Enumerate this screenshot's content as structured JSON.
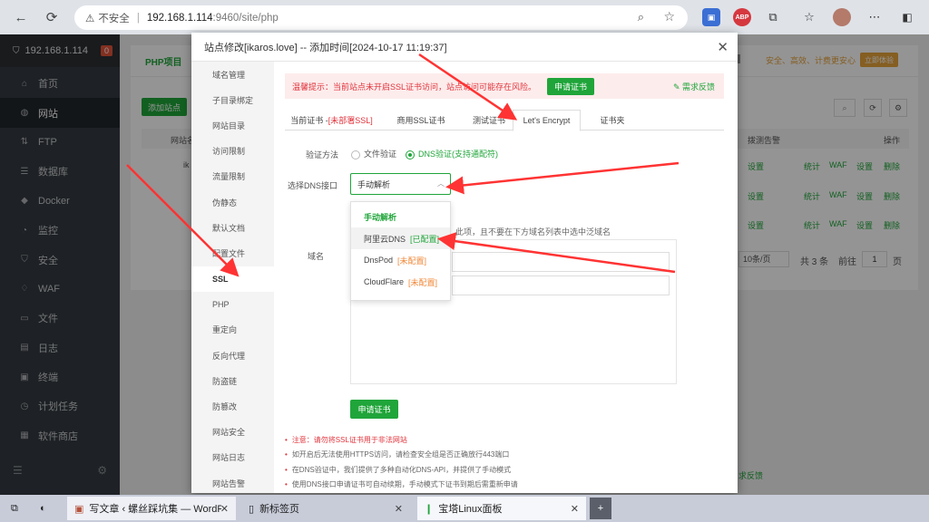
{
  "browser": {
    "not_secure": "不安全",
    "url_host": "192.168.1.114",
    "url_path": ":9460/site/php",
    "ext_abp": "ABP"
  },
  "sidebar": {
    "server": "192.168.1.114",
    "badge": "0",
    "items": [
      "首页",
      "网站",
      "FTP",
      "数据库",
      "Docker",
      "监控",
      "安全",
      "WAF",
      "文件",
      "日志",
      "终端",
      "计划任务",
      "软件商店"
    ]
  },
  "panel": {
    "tab": "PHP项目",
    "add_site": "添加站点",
    "col_site": "网站名",
    "col_alarm": "拨测告警",
    "col_ops": "操作",
    "row_ik": "ik",
    "setting": "设置",
    "stats": "统计",
    "waf": "WAF",
    "delete": "删除",
    "banner": "安全、高效、计费更安心",
    "try_btn": "立即体验",
    "page_size": "10条/页",
    "total": "共 3 条",
    "goto": "前往",
    "page_no": "1",
    "page_unit": "页",
    "footer_link": "求反馈"
  },
  "modal": {
    "title": "站点修改[ikaros.love] -- 添加时间[2024-10-17 11:19:37]",
    "menu": [
      "域名管理",
      "子目录绑定",
      "网站目录",
      "访问限制",
      "流量限制",
      "伪静态",
      "默认文档",
      "配置文件",
      "SSL",
      "PHP",
      "重定向",
      "反向代理",
      "防盗链",
      "防篡改",
      "网站安全",
      "网站日志",
      "网站告警"
    ],
    "tip": "温馨提示：当前站点未开启SSL证书访问，站点访问可能存在风险。",
    "tip_btn": "申请证书",
    "feedback": "需求反馈",
    "tabs": {
      "current_prefix": "当前证书 - ",
      "current_state": "[未部署SSL]",
      "commercial": "商用SSL证书",
      "test": "测试证书",
      "le": "Let's Encrypt",
      "folder": "证书夹"
    },
    "verify_label": "验证方法",
    "verify_file": "文件验证",
    "verify_dns": "DNS验证(支持通配符)",
    "dns_label": "选择DNS接口",
    "dns_value": "手动解析",
    "dropdown": [
      {
        "name": "手动解析",
        "status": ""
      },
      {
        "name": "阿里云DNS",
        "status": "[已配置]"
      },
      {
        "name": "DnsPod",
        "status": "[未配置]"
      },
      {
        "name": "CloudFlare",
        "status": "[未配置]"
      }
    ],
    "hint": "此项，且不要在下方域名列表中选中泛域名",
    "domain_label": "域名",
    "apply_btn": "申请证书",
    "notes": [
      "注意：请勿将SSL证书用于非法网站",
      "如开启后无法使用HTTPS访问，请检查安全组是否正确放行443端口",
      "在DNS验证中，我们提供了多种自动化DNS-API，并提供了手动模式",
      "使用DNS接口申请证书可自动续期，手动模式下证书到期后需重新申请"
    ]
  },
  "taskbar": {
    "tab1": "写文章 ‹ 螺丝踩坑集 — WordPress",
    "tab2": "新标签页",
    "tab3": "宝塔Linux面板"
  },
  "colors": {
    "accent": "#20a53a",
    "danger": "#e0343c",
    "arrow": "#ff3333"
  }
}
